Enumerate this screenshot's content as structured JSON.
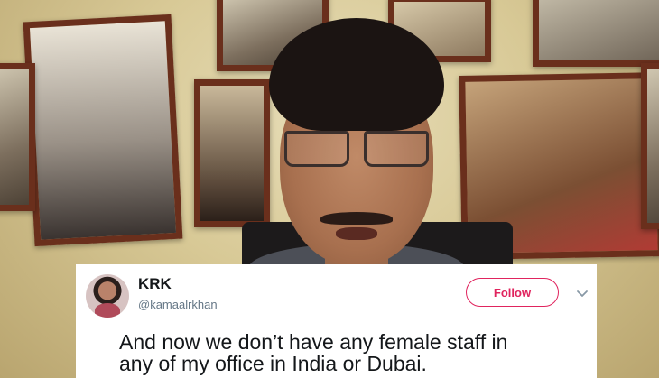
{
  "tweet": {
    "name": "KRK",
    "handle": "@kamaalrkhan",
    "follow_label": "Follow",
    "text_line_1": "And now we don’t have any female staff in",
    "text_line_2": "any of my office in India or Dubai.",
    "follow_color": "#e0245e",
    "more_icon": "chevron-down-icon"
  }
}
